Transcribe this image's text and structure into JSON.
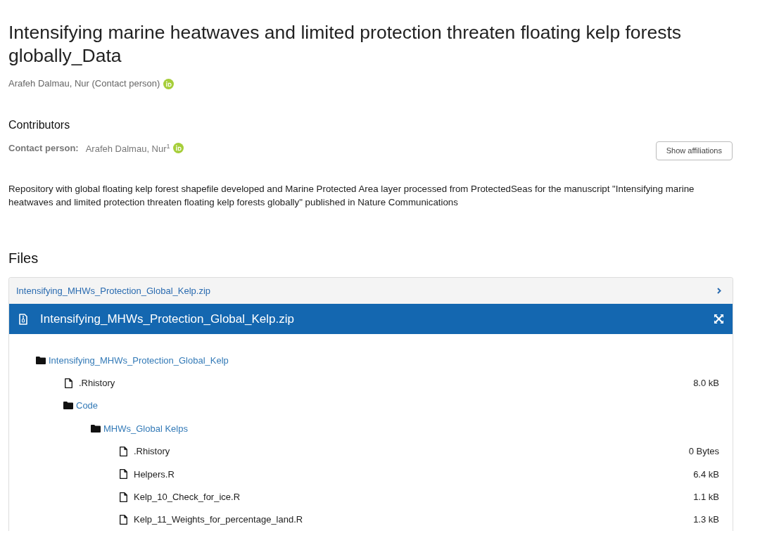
{
  "record": {
    "title": "Intensifying marine heatwaves and limited protection threaten floating kelp forests globally_Data",
    "creators": [
      {
        "name": "Arafeh Dalmau, Nur (Contact person)",
        "orcid": true
      }
    ]
  },
  "contributors": {
    "heading": "Contributors",
    "items": [
      {
        "role": "Contact person:",
        "name": "Arafeh Dalmau, Nur$^{1}$",
        "orcid": true
      }
    ],
    "affiliations_button": "Show affiliations"
  },
  "description": "Repository with global floating kelp forest shapefile developed and Marine Protected Area layer processed from ProtectedSeas for the manuscript \"Intensifying marine heatwaves and limited protection threaten floating kelp forests globally\" published in Nature Communications",
  "files": {
    "heading": "Files",
    "archive_link": "Intensifying_MHWs_Protection_Global_Kelp.zip",
    "preview": {
      "title": "Intensifying_MHWs_Protection_Global_Kelp.zip",
      "tree": [
        {
          "kind": "folder",
          "name": "Intensifying_MHWs_Protection_Global_Kelp",
          "children": [
            {
              "kind": "file",
              "name": ".Rhistory",
              "size": "8.0 kB"
            },
            {
              "kind": "folder",
              "name": "Code",
              "children": [
                {
                  "kind": "folder",
                  "name": "MHWs_Global Kelps",
                  "children": [
                    {
                      "kind": "file",
                      "name": ".Rhistory",
                      "size": "0 Bytes"
                    },
                    {
                      "kind": "file",
                      "name": "Helpers.R",
                      "size": "6.4 kB"
                    },
                    {
                      "kind": "file",
                      "name": "Kelp_10_Check_for_ice.R",
                      "size": "1.1 kB"
                    },
                    {
                      "kind": "file",
                      "name": "Kelp_11_Weights_for_percentage_land.R",
                      "size": "1.3 kB"
                    }
                  ]
                }
              ]
            }
          ]
        }
      ]
    }
  }
}
